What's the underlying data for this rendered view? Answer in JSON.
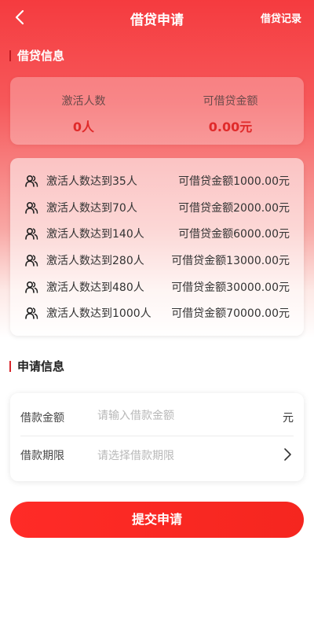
{
  "header": {
    "title": "借贷申请",
    "right_link": "借贷记录"
  },
  "loan_info": {
    "section_title": "借贷信息",
    "summary": {
      "activated_label": "激活人数",
      "activated_value": "0人",
      "amount_label": "可借贷金额",
      "amount_value": "0.00元"
    },
    "tiers": [
      {
        "condition": "激活人数达到35人",
        "amount": "可借贷金额1000.00元"
      },
      {
        "condition": "激活人数达到70人",
        "amount": "可借贷金额2000.00元"
      },
      {
        "condition": "激活人数达到140人",
        "amount": "可借贷金额6000.00元"
      },
      {
        "condition": "激活人数达到280人",
        "amount": "可借贷金额13000.00元"
      },
      {
        "condition": "激活人数达到480人",
        "amount": "可借贷金额30000.00元"
      },
      {
        "condition": "激活人数达到1000人",
        "amount": "可借贷金额70000.00元"
      }
    ],
    "tier_icon": "users-icon"
  },
  "apply_info": {
    "section_title": "申请信息",
    "amount_label": "借款金额",
    "amount_placeholder": "请输入借款金额",
    "amount_value": "",
    "amount_unit": "元",
    "term_label": "借款期限",
    "term_placeholder": "请选择借款期限"
  },
  "submit_label": "提交申请",
  "colors": {
    "brand_red": "#f53b3f",
    "value_red": "#e02a2a",
    "button_red": "#ff2b27"
  }
}
